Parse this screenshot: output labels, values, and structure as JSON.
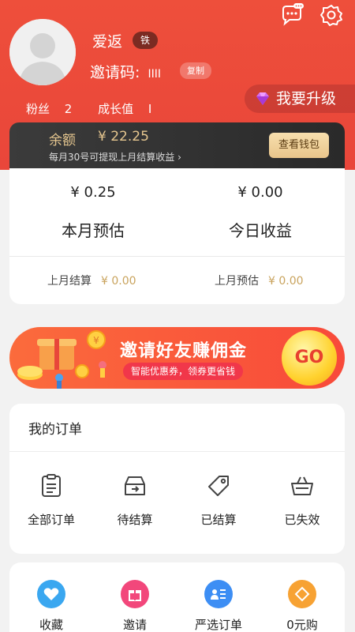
{
  "header": {
    "username": "爱返",
    "level_badge": "铁",
    "invite_label": "邀请码:",
    "invite_code": "IIII",
    "copy_button": "复制",
    "fans_label": "粉丝",
    "fans_count": "2",
    "growth_label": "成长值",
    "growth_value": "I",
    "upgrade_label": "我要升级",
    "icons": [
      "chat-icon",
      "gear-icon",
      "gem-icon"
    ]
  },
  "wallet": {
    "balance_label": "余额",
    "balance_value": "¥ 22.25",
    "note": "每月30号可提现上月结算收益",
    "button": "查看钱包"
  },
  "earnings": {
    "month_amount": "¥ 0.25",
    "month_label": "本月预估",
    "today_amount": "¥ 0.00",
    "today_label": "今日收益",
    "last_settled_label": "上月结算",
    "last_settled_value": "¥ 0.00",
    "last_estimate_label": "上月预估",
    "last_estimate_value": "¥ 0.00"
  },
  "banner": {
    "title": "邀请好友赚佣金",
    "subtitle": "智能优惠券，领券更省钱",
    "go": "GO"
  },
  "orders": {
    "title": "我的订单",
    "items": [
      {
        "label": "全部订单",
        "icon": "clipboard-icon"
      },
      {
        "label": "待结算",
        "icon": "inbox-icon"
      },
      {
        "label": "已结算",
        "icon": "tag-icon"
      },
      {
        "label": "已失效",
        "icon": "basket-icon"
      }
    ]
  },
  "tools": {
    "items": [
      {
        "label": "收藏",
        "icon": "heart-icon",
        "color": "#3aa7f0"
      },
      {
        "label": "邀请",
        "icon": "gift-icon",
        "color": "#f2477b"
      },
      {
        "label": "严选订单",
        "icon": "list-user-icon",
        "color": "#3d8ef4"
      },
      {
        "label": "0元购",
        "icon": "diamond-icon",
        "color": "#f7a233"
      }
    ]
  },
  "colors": {
    "header_red": "#ec4b3a",
    "gold": "#e5c68f",
    "price_gold": "#c9a35d"
  }
}
